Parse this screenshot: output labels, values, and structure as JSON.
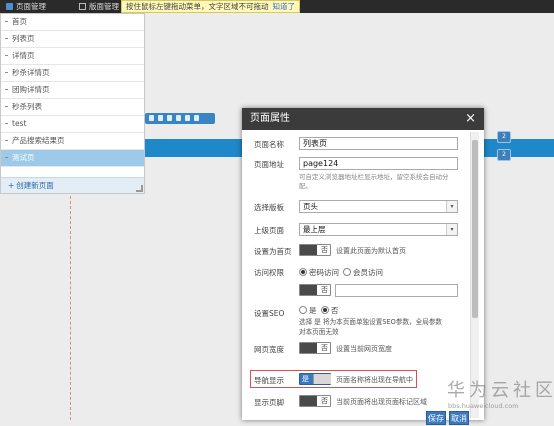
{
  "topbar": {
    "page_manage": "页面管理",
    "layout_manage": "版面管理",
    "tip": "按住鼠标左键拖动菜单，文字区域不可拖动",
    "tip_link": "知道了"
  },
  "page_menu": {
    "items": [
      "首页",
      "列表页",
      "详情页",
      "秒杀详情页",
      "团购详情页",
      "秒杀列表",
      "test",
      "产品搜索结果页",
      "测试页"
    ],
    "active_index": 8,
    "create_label": "创建新页面"
  },
  "modal": {
    "title": "页面属性",
    "fields": {
      "page_name": {
        "label": "页面名称",
        "value": "列表页"
      },
      "page_address": {
        "label": "页面地址",
        "value": "page124",
        "hint": "可自定义浏览器地址栏显示地址，留空系统会自动分配。"
      },
      "choose_layout": {
        "label": "选择版板",
        "value": "页头"
      },
      "parent_page": {
        "label": "上级页面",
        "value": "最上层"
      },
      "set_homepage": {
        "label": "设置为首页",
        "toggle_text": "否",
        "desc": "设置此页面为默认首页"
      },
      "access": {
        "label": "访问权限",
        "options": [
          "密码访问",
          "会员访问"
        ],
        "selected": 0,
        "toggle_text": "否"
      },
      "seo": {
        "label": "设置SEO",
        "options": [
          "是",
          "否"
        ],
        "selected": 1,
        "desc_line1": "选择 是 将为本页面单独设置SEO参数，全局参数",
        "desc_line2": "对本页面无效"
      },
      "page_width": {
        "label": "网页宽度",
        "toggle_text": "否",
        "desc": "设置当前网页宽度"
      },
      "nav_display": {
        "label": "导航显示",
        "toggle_text": "是",
        "desc": "页面名称将出现在导航中"
      },
      "display_page": {
        "label": "显示页脚",
        "toggle_text": "否",
        "desc": "当前页面将出现页面标记区域"
      }
    },
    "buttons": {
      "save": "保存",
      "cancel": "取消"
    }
  },
  "watermark": {
    "text": "华为云社区",
    "url": "bbs.huaweicloud.com"
  },
  "side_marks": [
    "2",
    "2"
  ],
  "colors": {
    "accent": "#3a78c0",
    "band": "#1e88c8",
    "active_item": "#9ccae8",
    "topbar": "#2a2a2a"
  }
}
